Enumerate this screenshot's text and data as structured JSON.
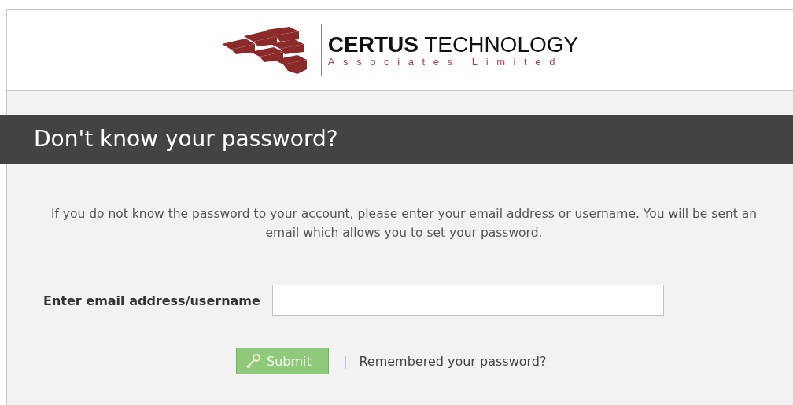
{
  "header": {
    "logo_name": "**CERTUS** TECHNOLOGY",
    "logo_tagline": "Associates Limited"
  },
  "title": "Don't know your password?",
  "instructions": "If you do not know the password to your account, please enter your email address or username. You will be sent an email which allows you to set your password.",
  "form": {
    "label": "Enter email address/username",
    "submit": "Submit",
    "separator": "|",
    "link": "Remembered your password?"
  }
}
